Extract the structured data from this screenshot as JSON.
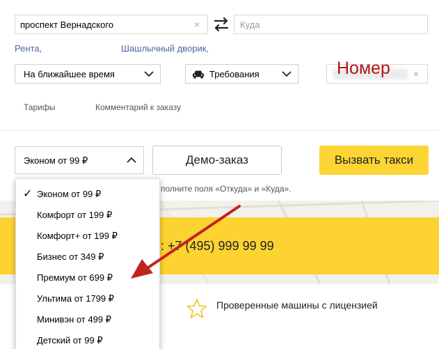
{
  "route": {
    "from_value": "проспект Вернадского",
    "to_placeholder": "Куда",
    "clear_symbol": "×"
  },
  "suggestions": [
    "Рента,",
    "Шашлычный дворик,"
  ],
  "time_select": {
    "label": "На ближайшее время"
  },
  "requirements_select": {
    "label": "Требования"
  },
  "number_field": {
    "overlay_text": "Номер",
    "clear_symbol": "×"
  },
  "tabs": [
    "Тарифы",
    "Комментарий к заказу"
  ],
  "tariff_select": {
    "label": "Эконом от 99 ₽"
  },
  "demo_button": "Демо-заказ",
  "call_button": "Вызвать такси",
  "hint": "полните поля «Откуда» и «Куда».",
  "phone": ": +7 (495) 999 99 99",
  "feature": "Проверенные машины с лицензией",
  "dropdown": {
    "check_symbol": "✓",
    "options": [
      "Эконом от 99 ₽",
      "Комфорт от 199 ₽",
      "Комфорт+ от 199 ₽",
      "Бизнес от 349 ₽",
      "Премиум от 699 ₽",
      "Ультима от 1799 ₽",
      "Минивэн от 499 ₽",
      "Детский от 99 ₽"
    ],
    "selected_index": 0
  },
  "colors": {
    "accent_yellow": "#fcd434",
    "link_blue": "#4a66a0",
    "annotation_red": "#b01616",
    "arrow_red": "#c0241e"
  },
  "icons": [
    "swap-icon",
    "car-icon",
    "chevron-down-icon",
    "chevron-up-icon",
    "star-icon",
    "close-icon",
    "check-icon"
  ]
}
